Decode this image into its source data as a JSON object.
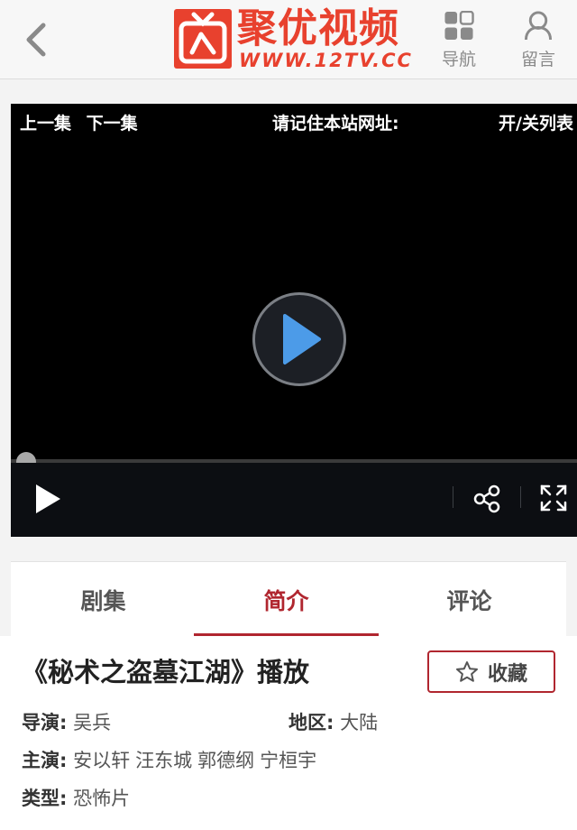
{
  "header": {
    "back_icon": "chevron-left-icon",
    "logo_title": "聚优视频",
    "logo_sub": "WWW.12TV.CC",
    "nav_label": "导航",
    "nav_icon": "grid-icon",
    "msg_label": "留言",
    "msg_icon": "user-icon"
  },
  "player": {
    "prev_label": "上一集",
    "next_label": "下一集",
    "site_note": "请记住本站网址:",
    "list_toggle": "开/关列表",
    "progress": 0,
    "colors": {
      "play_accent": "#4c9be8",
      "background": "#000000"
    }
  },
  "tabs": [
    {
      "label": "剧集",
      "active": false
    },
    {
      "label": "简介",
      "active": true
    },
    {
      "label": "评论",
      "active": false
    }
  ],
  "info": {
    "title": "《秘术之盗墓江湖》播放",
    "favorite_label": "收藏",
    "favorite_icon": "star-icon",
    "director_key": "导演:",
    "director": "吴兵",
    "region_key": "地区:",
    "region": "大陆",
    "cast_key": "主演:",
    "cast": [
      "安以轩",
      "汪东城",
      "郭德纲",
      "宁桓宇"
    ],
    "genre_key": "类型:",
    "genre": "恐怖片"
  },
  "colors": {
    "brand": "#e8412e",
    "accent": "#b0262f"
  }
}
